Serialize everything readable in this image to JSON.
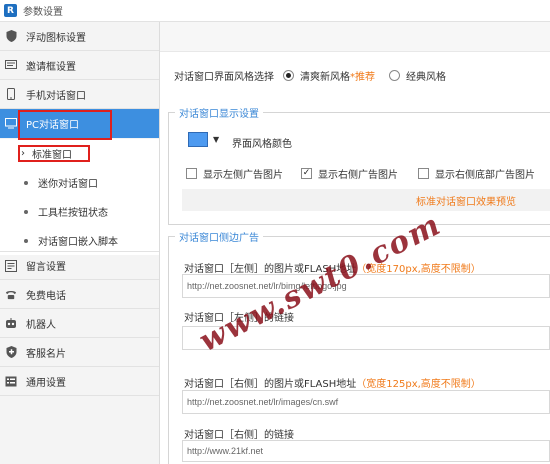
{
  "window": {
    "title": "参数设置",
    "app_icon_letter": "R"
  },
  "sidebar": {
    "items": [
      {
        "label": "浮动图标设置",
        "icon": "shield-icon"
      },
      {
        "label": "邀请框设置",
        "icon": "chat-box-icon"
      },
      {
        "label": "手机对话窗口",
        "icon": "phone-icon"
      },
      {
        "label": "PC对话窗口",
        "icon": "monitor-icon"
      },
      {
        "label": "留言设置",
        "icon": "message-icon"
      },
      {
        "label": "免费电话",
        "icon": "telephone-icon"
      },
      {
        "label": "机器人",
        "icon": "robot-icon"
      },
      {
        "label": "客服名片",
        "icon": "card-icon"
      },
      {
        "label": "通用设置",
        "icon": "settings-icon"
      }
    ],
    "subitems": [
      {
        "label": "标准窗口",
        "marker": "›"
      },
      {
        "label": "迷你对话窗口"
      },
      {
        "label": "工具栏按钮状态"
      },
      {
        "label": "对话窗口嵌入脚本"
      }
    ]
  },
  "main": {
    "style_label": "对话窗口界面风格选择",
    "style_options": [
      {
        "label": "清爽新风格",
        "suffix": "*推荐",
        "selected": true
      },
      {
        "label": "经典风格",
        "selected": false
      }
    ],
    "display_panel": {
      "heading": "对话窗口显示设置",
      "color_label": "界面风格颜色",
      "swatch_color": "#4d9af0",
      "checkboxes": [
        {
          "label": "显示左侧广告图片",
          "checked": false
        },
        {
          "label": "显示右侧广告图片",
          "checked": true
        },
        {
          "label": "显示右侧底部广告图片",
          "checked": false
        }
      ],
      "preview_link": "标准对话窗口效果预览"
    },
    "ads_panel": {
      "heading": "对话窗口侧边广告",
      "left_image_label": "对话窗口［左侧］的图片或FLASH地址",
      "left_image_hint": "（宽度170px,高度不限制）",
      "left_image_value": "http://net.zoosnet.net/lr/bimg/leftlogo.jpg",
      "left_link_label": "对话窗口［左侧］的链接",
      "left_link_value": "",
      "right_image_label": "对话窗口［右侧］的图片或FLASH地址",
      "right_image_hint": "（宽度125px,高度不限制）",
      "right_image_value": "http://net.zoosnet.net/lr/images/cn.swf",
      "right_link_label": "对话窗口［右侧］的链接",
      "right_link_value": "http://www.21kf.net"
    }
  },
  "watermark": "www.swt0.com"
}
